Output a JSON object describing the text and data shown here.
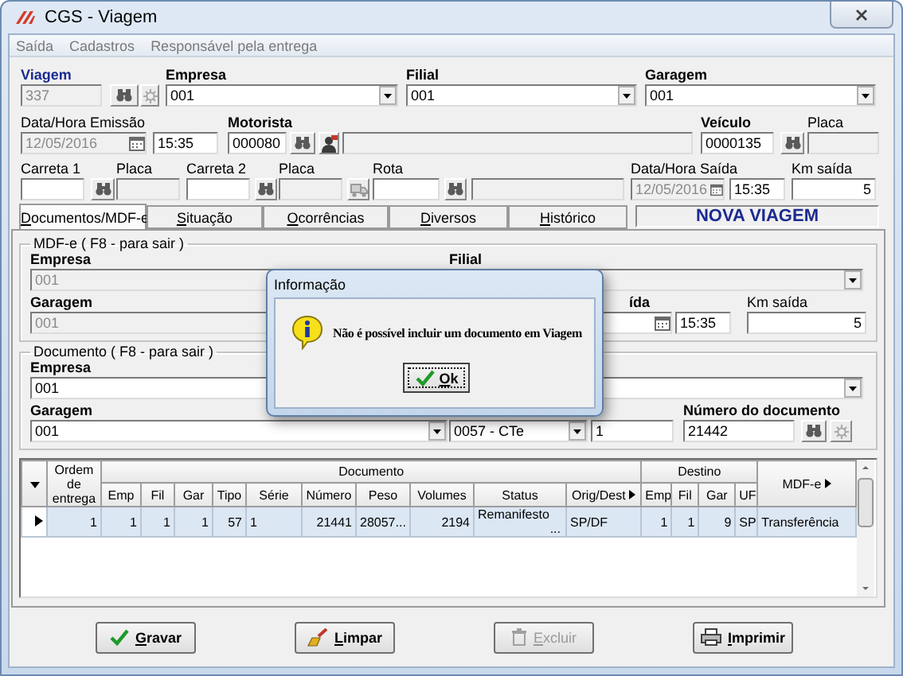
{
  "window": {
    "title": "CGS - Viagem"
  },
  "menu": [
    "Saída",
    "Cadastros",
    "Responsável pela entrega"
  ],
  "header": {
    "viagem": {
      "label": "Viagem",
      "value": "337",
      "disabled": true
    },
    "empresa": {
      "label": "Empresa",
      "value": "001"
    },
    "filial": {
      "label": "Filial",
      "value": "001"
    },
    "garagem": {
      "label": "Garagem",
      "value": "001"
    },
    "emissao": {
      "label": "Data/Hora Emissão",
      "date": "12/05/2016",
      "time": "15:35",
      "disabled": true
    },
    "motorista": {
      "label": "Motorista",
      "value": "000080"
    },
    "veiculo": {
      "label": "Veículo",
      "value": "0000135"
    },
    "placa": {
      "label": "Placa"
    },
    "carreta_1": {
      "label": "Carreta 1"
    },
    "placa_1": {
      "label": "Placa"
    },
    "carreta_2": {
      "label": "Carreta 2"
    },
    "placa_2": {
      "label": "Placa"
    },
    "rota": {
      "label": "Rota"
    },
    "saida": {
      "label": "Data/Hora Saída",
      "date": "12/05/2016",
      "time": "15:35",
      "disabled": true
    },
    "km_saida": {
      "label": "Km saída",
      "value": "5"
    }
  },
  "tabs": [
    {
      "label": "Documentos/MDF-e",
      "selected": true
    },
    {
      "label": "Situação",
      "selected": false
    },
    {
      "label": "Ocorrências",
      "selected": false
    },
    {
      "label": "Diversos",
      "selected": false
    },
    {
      "label": "Histórico",
      "selected": false
    }
  ],
  "status_banner": "NOVA VIAGEM",
  "mdfe_group": {
    "title": "MDF-e ( F8 - para sair )",
    "empresa": {
      "label": "Empresa",
      "value": "001",
      "disabled": true
    },
    "filial": {
      "label": "Filial",
      "disabled": true
    },
    "garagem": {
      "label": "Garagem",
      "value": "001",
      "disabled": true
    },
    "saida_label": "ída",
    "saida_time": "15:35",
    "km_saida": {
      "label": "Km saída",
      "value": "5"
    }
  },
  "documento_group": {
    "title": "Documento ( F8 - para sair )",
    "empresa": {
      "label": "Empresa",
      "value": "001"
    },
    "garagem": {
      "label": "Garagem",
      "value": "001"
    },
    "tipo": "0057 - CTe",
    "serie": "1",
    "numero": {
      "label": "Número do documento",
      "value": "21442"
    }
  },
  "grid": {
    "lead_column": "Ordem de entrega",
    "column_groups": [
      {
        "label": "Documento",
        "columns": [
          {
            "label": "Emp"
          },
          {
            "label": "Fil"
          },
          {
            "label": "Gar"
          },
          {
            "label": "Tipo"
          },
          {
            "label": "Série"
          },
          {
            "label": "Número"
          },
          {
            "label": "Peso"
          },
          {
            "label": "Volumes"
          },
          {
            "label": "Status"
          },
          {
            "label": "Orig/Dest",
            "expandable": true
          }
        ]
      },
      {
        "label": "Destino",
        "columns": [
          {
            "label": "Emp"
          },
          {
            "label": "Fil"
          },
          {
            "label": "Gar"
          },
          {
            "label": "UF"
          }
        ]
      }
    ],
    "tail_column": {
      "label": "MDF-e",
      "expandable": true
    },
    "rows": [
      {
        "selected": true,
        "cells": [
          "1",
          "1",
          "1",
          "1",
          "57",
          "1",
          "21441",
          "28057...",
          "2194",
          "Remanifesto",
          "SP/DF",
          "1",
          "1",
          "9",
          "SP",
          "Transferência"
        ],
        "status_button": "..."
      }
    ]
  },
  "buttons": [
    {
      "label": "Gravar",
      "kind": "save",
      "disabled": false
    },
    {
      "label": "Limpar",
      "kind": "clear",
      "disabled": false
    },
    {
      "label": "Excluir",
      "kind": "delete",
      "disabled": true
    },
    {
      "label": "Imprimir",
      "kind": "print",
      "disabled": false
    }
  ],
  "dialog": {
    "title": "Informação",
    "message": "Não é possível incluir um documento em Viagem",
    "button": "Ok"
  }
}
